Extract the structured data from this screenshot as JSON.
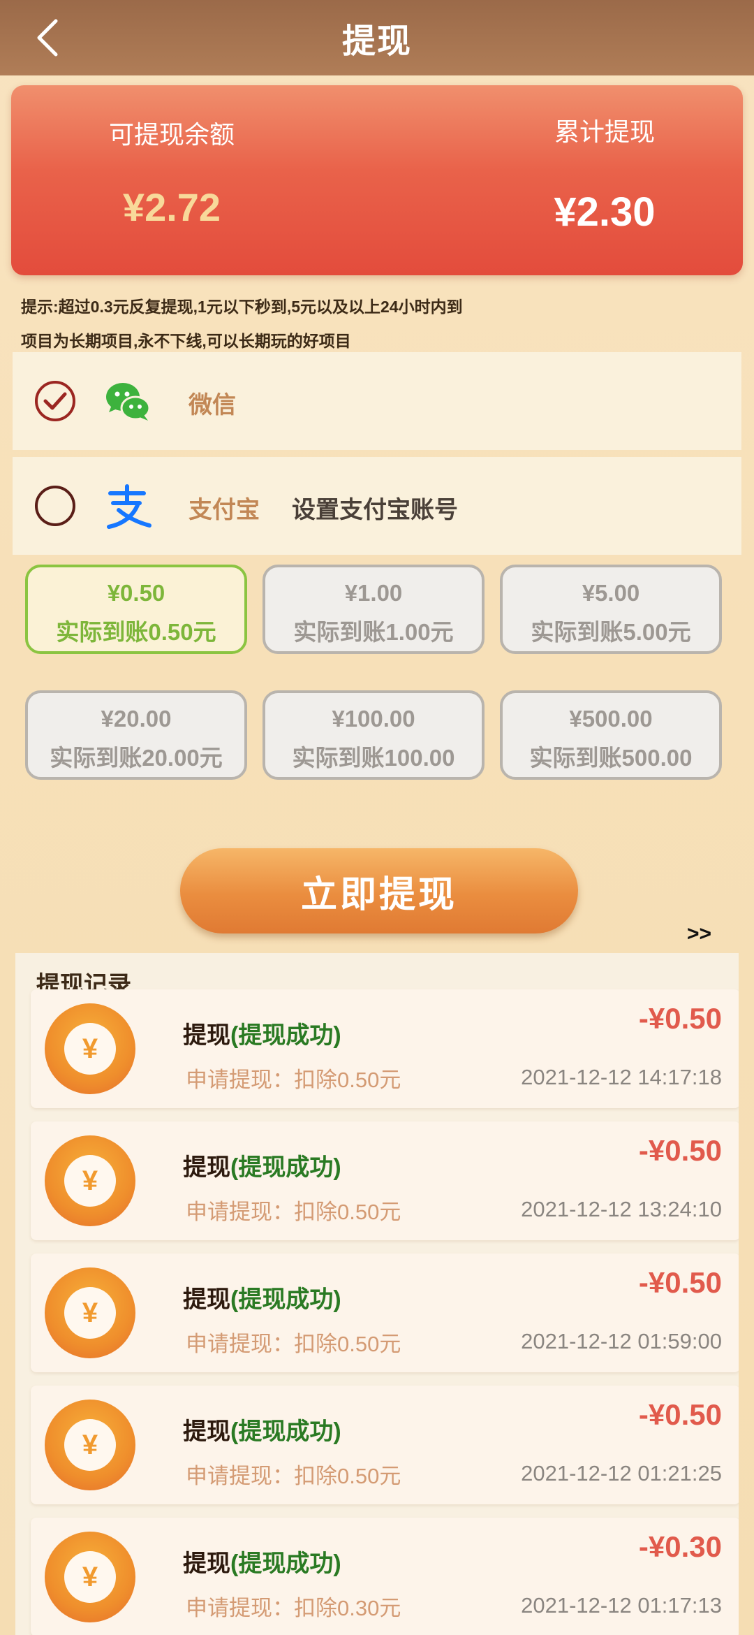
{
  "header": {
    "title": "提现"
  },
  "balance": {
    "available_label": "可提现余额",
    "available_value": "¥2.72",
    "total_label": "累计提现",
    "total_value": "¥2.30"
  },
  "tips": [
    "提示:超过0.3元反复提现,1元以下秒到,5元以及以上24小时内到",
    "项目为长期项目,永不下线,可以长期玩的好项目"
  ],
  "payment": {
    "wechat": {
      "name": "微信",
      "selected": true
    },
    "alipay": {
      "name": "支付宝",
      "action": "设置支付宝账号",
      "selected": false
    }
  },
  "amounts": [
    {
      "value": "¥0.50",
      "desc": "实际到账0.50元",
      "selected": true
    },
    {
      "value": "¥1.00",
      "desc": "实际到账1.00元",
      "selected": false
    },
    {
      "value": "¥5.00",
      "desc": "实际到账5.00元",
      "selected": false
    },
    {
      "value": "¥20.00",
      "desc": "实际到账20.00元",
      "selected": false
    },
    {
      "value": "¥100.00",
      "desc": "实际到账100.00",
      "selected": false
    },
    {
      "value": "¥500.00",
      "desc": "实际到账500.00",
      "selected": false
    }
  ],
  "submit_label": "立即提现",
  "more_label": ">>",
  "records": {
    "title": "提现记录",
    "items": [
      {
        "title": "提现",
        "status": "(提现成功)",
        "desc": "申请提现：扣除0.50元",
        "amount": "-¥0.50",
        "time": "2021-12-12  14:17:18"
      },
      {
        "title": "提现",
        "status": "(提现成功)",
        "desc": "申请提现：扣除0.50元",
        "amount": "-¥0.50",
        "time": "2021-12-12  13:24:10"
      },
      {
        "title": "提现",
        "status": "(提现成功)",
        "desc": "申请提现：扣除0.50元",
        "amount": "-¥0.50",
        "time": "2021-12-12  01:59:00"
      },
      {
        "title": "提现",
        "status": "(提现成功)",
        "desc": "申请提现：扣除0.50元",
        "amount": "-¥0.50",
        "time": "2021-12-12  01:21:25"
      },
      {
        "title": "提现",
        "status": "(提现成功)",
        "desc": "申请提现：扣除0.30元",
        "amount": "-¥0.30",
        "time": "2021-12-12  01:17:13"
      }
    ]
  },
  "coin_symbol": "¥",
  "colors": {
    "header": "#a6724f",
    "card": "#e9624a",
    "selected": "#8bc441",
    "amount_negative": "#e15a4c",
    "status_success": "#2a7a23"
  }
}
